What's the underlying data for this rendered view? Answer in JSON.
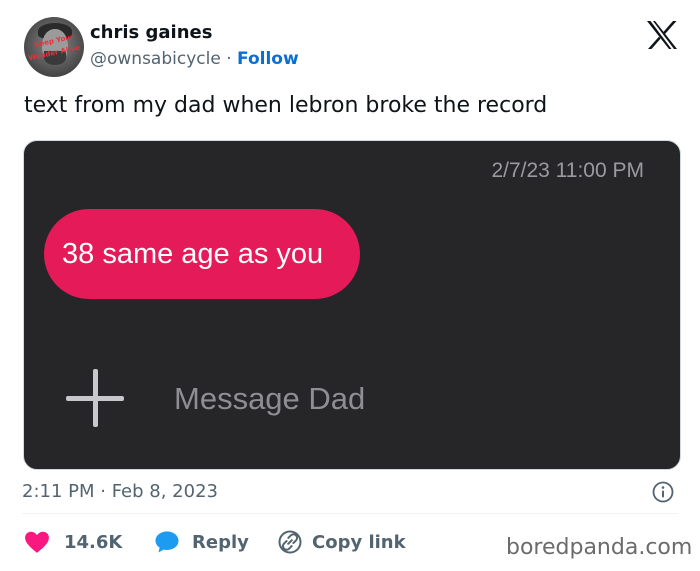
{
  "author": {
    "name": "chris gaines",
    "handle": "@ownsabicycle",
    "separator": "·",
    "follow_label": "Follow",
    "avatar_caption_top": "Keep Your",
    "avatar_caption_bottom": "Wonder Alive"
  },
  "tweet": {
    "text": "text from my dad when lebron broke the record",
    "timestamp": "2:11 PM · Feb 8, 2023"
  },
  "media": {
    "message_time": "2/7/23 11:00 PM",
    "message_text": "38 same age as you",
    "compose_placeholder": "Message Dad",
    "bubble_color": "#e51a58",
    "background_color": "#262629"
  },
  "actions": {
    "like_count": "14.6K",
    "reply_label": "Reply",
    "copy_label": "Copy link"
  },
  "icons": {
    "x_logo": "x-logo-icon",
    "info": "info-icon",
    "like": "heart-icon",
    "reply": "speech-bubble-icon",
    "copy": "link-icon",
    "add": "plus-icon"
  },
  "colors": {
    "like": "#f91880",
    "reply": "#1d9bf0",
    "follow": "#0a6fd3"
  },
  "watermark": "boredpanda.com"
}
